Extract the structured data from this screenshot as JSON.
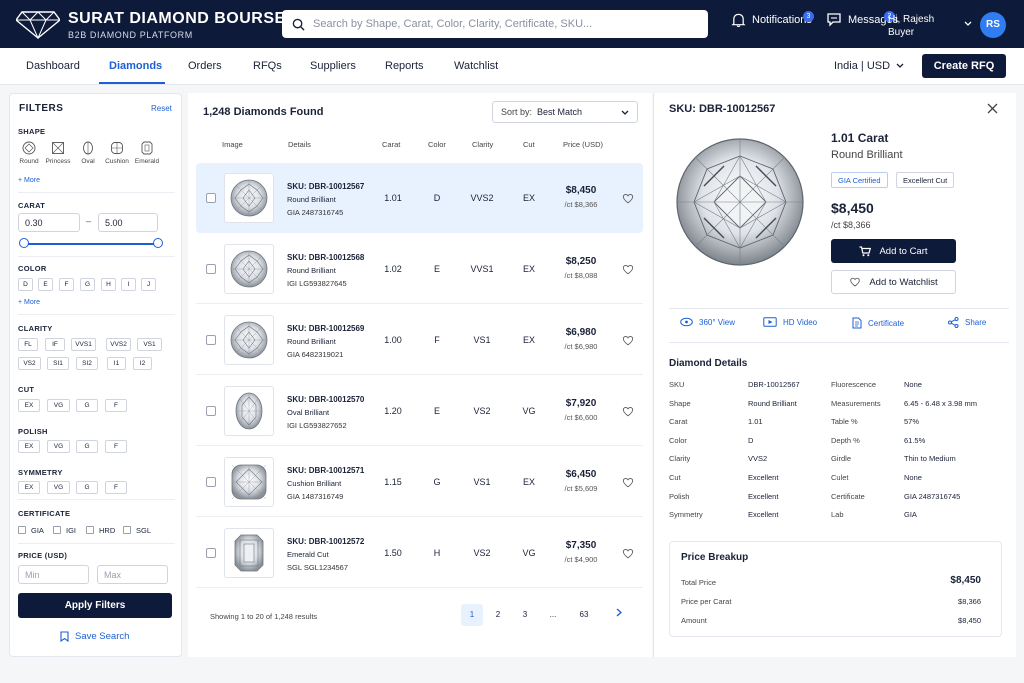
{
  "brand": {
    "name": "SURAT DIAMOND BOURSE",
    "subtitle": "B2B DIAMOND PLATFORM"
  },
  "search": {
    "placeholder": "Search by Shape, Carat, Color, Clarity, Certificate, SKU..."
  },
  "topnav": {
    "notifications": {
      "label": "Notifications",
      "count": "3"
    },
    "messages": {
      "label": "Messages",
      "count": "2"
    },
    "user": {
      "greeting": "Hi, Rajesh",
      "role": "Buyer",
      "initials": "RS"
    }
  },
  "tabs": [
    {
      "label": "Dashboard"
    },
    {
      "label": "Diamonds",
      "active": true
    },
    {
      "label": "Orders"
    },
    {
      "label": "RFQs"
    },
    {
      "label": "Suppliers"
    },
    {
      "label": "Reports"
    },
    {
      "label": "Watchlist"
    }
  ],
  "region": "India | USD",
  "create_rfq": "Create RFQ",
  "filters": {
    "title": "FILTERS",
    "reset": "Reset",
    "shape": {
      "title": "SHAPE",
      "options": [
        "Round",
        "Princess",
        "Oval",
        "Cushion",
        "Emerald"
      ],
      "more": "+ More"
    },
    "carat": {
      "title": "CARAT",
      "min": "0.30",
      "max": "5.00",
      "sep": "–"
    },
    "color": {
      "title": "COLOR",
      "options": [
        "D",
        "E",
        "F",
        "G",
        "H",
        "I",
        "J"
      ],
      "more": "+ More"
    },
    "clarity": {
      "title": "CLARITY",
      "options": [
        "FL",
        "IF",
        "VVS1",
        "VVS2",
        "VS1",
        "VS2",
        "SI1",
        "SI2",
        "I1",
        "I2"
      ]
    },
    "cut": {
      "title": "CUT",
      "options": [
        "EX",
        "VG",
        "G",
        "F"
      ]
    },
    "polish": {
      "title": "POLISH",
      "options": [
        "EX",
        "VG",
        "G",
        "F"
      ]
    },
    "symmetry": {
      "title": "SYMMETRY",
      "options": [
        "EX",
        "VG",
        "G",
        "F"
      ]
    },
    "certificate": {
      "title": "CERTIFICATE",
      "options": [
        "GIA",
        "IGI",
        "HRD",
        "SGL"
      ]
    },
    "price": {
      "title": "PRICE (USD)",
      "min_placeholder": "Min",
      "max_placeholder": "Max"
    },
    "apply": "Apply Filters",
    "save": "Save Search"
  },
  "results": {
    "count": "1,248 Diamonds Found",
    "sort_label": "Sort by:",
    "sort_value": "Best Match",
    "columns": [
      "Image",
      "Details",
      "Carat",
      "Color",
      "Clarity",
      "Cut",
      "Price (USD)"
    ],
    "rows": [
      {
        "sku": "SKU: DBR-10012567",
        "shape": "Round Brilliant",
        "cert": "GIA 2487316745",
        "carat": "1.01",
        "color": "D",
        "clarity": "VVS2",
        "cut": "EX",
        "price": "$8,450",
        "ppc": "/ct $8,366",
        "icon": "round-diamond-icon"
      },
      {
        "sku": "SKU: DBR-10012568",
        "shape": "Round Brilliant",
        "cert": "IGI LG593827645",
        "carat": "1.02",
        "color": "E",
        "clarity": "VVS1",
        "cut": "EX",
        "price": "$8,250",
        "ppc": "/ct $8,088",
        "icon": "round-diamond-icon"
      },
      {
        "sku": "SKU: DBR-10012569",
        "shape": "Round Brilliant",
        "cert": "GIA 6482319021",
        "carat": "1.00",
        "color": "F",
        "clarity": "VS1",
        "cut": "EX",
        "price": "$6,980",
        "ppc": "/ct $6,980",
        "icon": "round-diamond-icon"
      },
      {
        "sku": "SKU: DBR-10012570",
        "shape": "Oval Brilliant",
        "cert": "IGI LG593827652",
        "carat": "1.20",
        "color": "E",
        "clarity": "VS2",
        "cut": "VG",
        "price": "$7,920",
        "ppc": "/ct $6,600",
        "icon": "oval-diamond-icon"
      },
      {
        "sku": "SKU: DBR-10012571",
        "shape": "Cushion Brilliant",
        "cert": "GIA 1487316749",
        "carat": "1.15",
        "color": "G",
        "clarity": "VS1",
        "cut": "EX",
        "price": "$6,450",
        "ppc": "/ct $5,609",
        "icon": "cushion-diamond-icon"
      },
      {
        "sku": "SKU: DBR-10012572",
        "shape": "Emerald Cut",
        "cert": "SGL SGL1234567",
        "carat": "1.50",
        "color": "H",
        "clarity": "VS2",
        "cut": "VG",
        "price": "$7,350",
        "ppc": "/ct $4,900",
        "icon": "emerald-diamond-icon"
      }
    ],
    "showing": "Showing 1 to 20 of 1,248 results",
    "pages": [
      "1",
      "2",
      "3",
      "...",
      "63"
    ]
  },
  "detail": {
    "sku": "SKU: DBR-10012567",
    "carat": "1.01 Carat",
    "shape": "Round Brilliant",
    "tags": [
      "GIA Certified",
      "Excellent Cut"
    ],
    "price": "$8,450",
    "ppc": "/ct $8,366",
    "add_to_cart": "Add to Cart",
    "add_to_watchlist": "Add to Watchlist",
    "actions": [
      "360° View",
      "HD Video",
      "Certificate",
      "Share"
    ],
    "details_title": "Diamond Details",
    "left_specs": [
      {
        "label": "SKU",
        "value": "DBR-10012567"
      },
      {
        "label": "Shape",
        "value": "Round Brilliant"
      },
      {
        "label": "Carat",
        "value": "1.01"
      },
      {
        "label": "Color",
        "value": "D"
      },
      {
        "label": "Clarity",
        "value": "VVS2"
      },
      {
        "label": "Cut",
        "value": "Excellent"
      },
      {
        "label": "Polish",
        "value": "Excellent"
      },
      {
        "label": "Symmetry",
        "value": "Excellent"
      }
    ],
    "right_specs": [
      {
        "label": "Fluorescence",
        "value": "None"
      },
      {
        "label": "Measurements",
        "value": "6.45 - 6.48 x 3.98 mm"
      },
      {
        "label": "Table %",
        "value": "57%"
      },
      {
        "label": "Depth %",
        "value": "61.5%"
      },
      {
        "label": "Girdle",
        "value": "Thin to Medium"
      },
      {
        "label": "Culet",
        "value": "None"
      },
      {
        "label": "Certificate",
        "value": "GIA 2487316745"
      },
      {
        "label": "Lab",
        "value": "GIA"
      }
    ],
    "breakup": {
      "title": "Price Breakup",
      "items": [
        {
          "label": "Total Price",
          "value": "$8,450"
        },
        {
          "label": "Price per Carat",
          "value": "$8,366"
        },
        {
          "label": "Amount",
          "value": "$8,450"
        }
      ]
    }
  },
  "colors": {
    "navy": "#0e1a3a",
    "accent": "#1d5fd6",
    "selected_row": "#e8f1fe"
  }
}
